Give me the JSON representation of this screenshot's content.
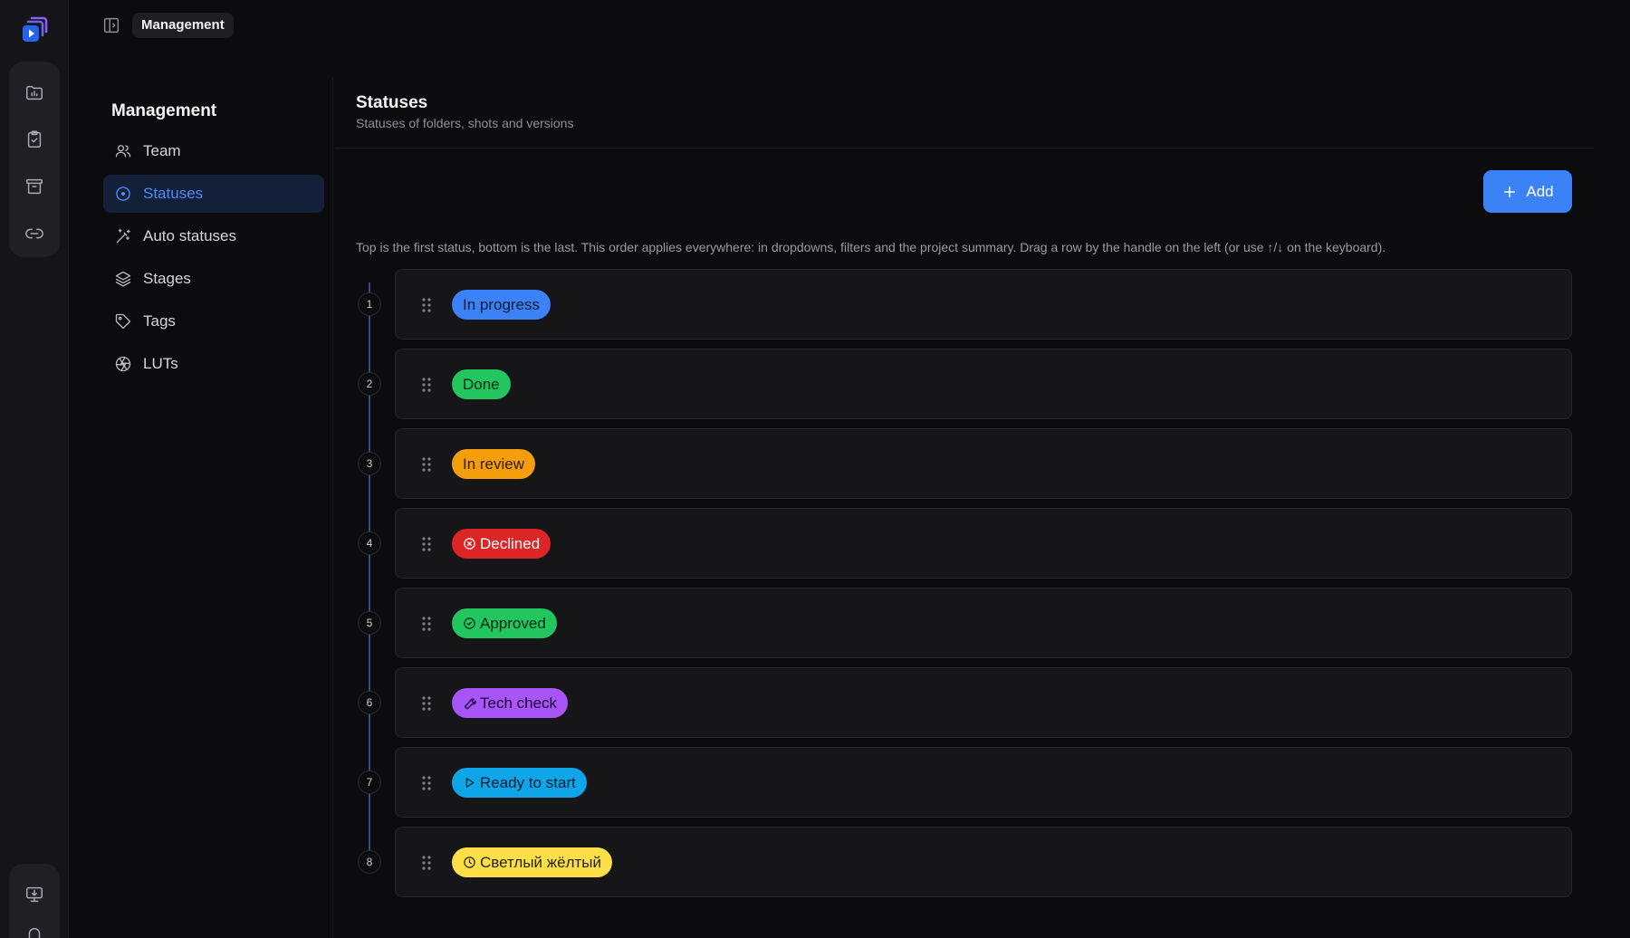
{
  "breadcrumb": {
    "current": "Management"
  },
  "rail": {
    "top_icons": [
      "folder-chart-icon",
      "clipboard-check-icon",
      "archive-icon",
      "link-icon"
    ],
    "bottom_icons": [
      "monitor-download-icon",
      "bell-icon"
    ]
  },
  "nav": {
    "title": "Management",
    "items": [
      {
        "label": "Team",
        "icon": "users-icon",
        "active": false
      },
      {
        "label": "Statuses",
        "icon": "circle-dot-icon",
        "active": true
      },
      {
        "label": "Auto statuses",
        "icon": "magic-wand-icon",
        "active": false
      },
      {
        "label": "Stages",
        "icon": "layers-icon",
        "active": false
      },
      {
        "label": "Tags",
        "icon": "tag-icon",
        "active": false
      },
      {
        "label": "LUTs",
        "icon": "aperture-icon",
        "active": false
      }
    ]
  },
  "main": {
    "title": "Statuses",
    "subtitle": "Statuses of folders, shots and versions",
    "add_label": "Add",
    "hint": "Top is the first status, bottom is the last. This order applies everywhere: in dropdowns, filters and the project summary. Drag a row by the handle on the left (or use ↑/↓ on the keyboard)."
  },
  "statuses": [
    {
      "order": "1",
      "label": "In progress",
      "color": "#3b82f6",
      "text_color": "#0b1a36",
      "icon": ""
    },
    {
      "order": "2",
      "label": "Done",
      "color": "#22c55e",
      "text_color": "#062a13",
      "icon": ""
    },
    {
      "order": "3",
      "label": "In review",
      "color": "#f59e0b",
      "text_color": "#2e1d00",
      "icon": ""
    },
    {
      "order": "4",
      "label": "Declined",
      "color": "#dc2626",
      "text_color": "#ffffff",
      "icon": "x-circle-icon"
    },
    {
      "order": "5",
      "label": "Approved",
      "color": "#22c55e",
      "text_color": "#062a13",
      "icon": "check-circle-icon"
    },
    {
      "order": "6",
      "label": "Tech check",
      "color": "#a855f7",
      "text_color": "#1e0636",
      "icon": "wrench-icon"
    },
    {
      "order": "7",
      "label": "Ready to start",
      "color": "#0ea5e9",
      "text_color": "#03202e",
      "icon": "play-icon"
    },
    {
      "order": "8",
      "label": "Светлый жёлтый",
      "color": "#fde047",
      "text_color": "#2a2300",
      "icon": "clock-icon"
    }
  ]
}
